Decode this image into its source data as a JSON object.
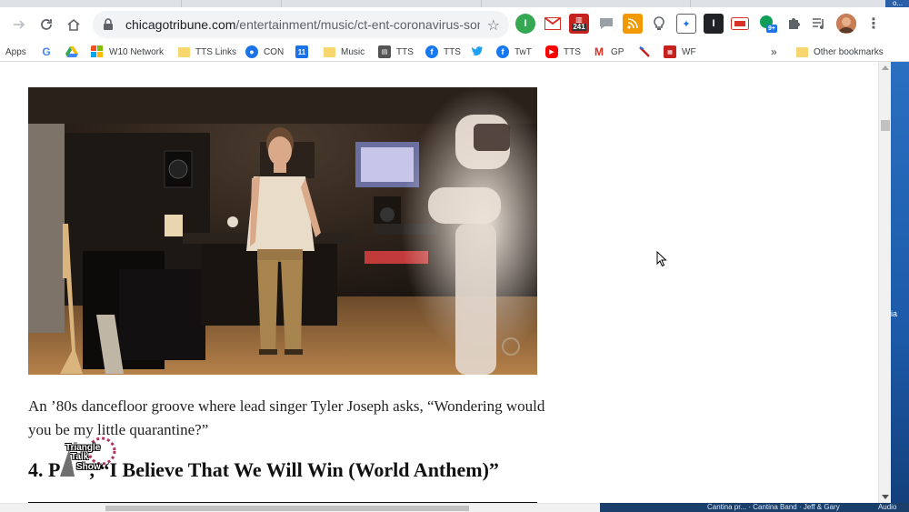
{
  "browser": {
    "url_host": "chicagotribune.com",
    "url_path": "/entertainment/music/ct-ent-coronavirus-song...",
    "badges": {
      "calendar": "241",
      "sync": "9+"
    }
  },
  "bookmarks": [
    {
      "label": "Apps",
      "icon": "apps-grid-icon"
    },
    {
      "label": "",
      "icon": "google-icon"
    },
    {
      "label": "",
      "icon": "drive-icon"
    },
    {
      "label": "W10 Network",
      "icon": "windows-icon"
    },
    {
      "label": "TTS Links",
      "icon": "folder-icon"
    },
    {
      "label": "CON",
      "icon": "person-icon"
    },
    {
      "label": "",
      "icon": "calendar-icon",
      "badge": "11"
    },
    {
      "label": "Music",
      "icon": "folder-icon"
    },
    {
      "label": "TTS",
      "icon": "tts-icon"
    },
    {
      "label": "TTS",
      "icon": "facebook-icon"
    },
    {
      "label": "",
      "icon": "twitter-icon"
    },
    {
      "label": "TwT",
      "icon": "facebook-icon"
    },
    {
      "label": "TTS",
      "icon": "youtube-icon"
    },
    {
      "label": "GP",
      "icon": "gmail-icon"
    },
    {
      "label": "",
      "icon": "feather-icon"
    },
    {
      "label": "WF",
      "icon": "wf-icon"
    }
  ],
  "bookmarks_more": "»",
  "other_bookmarks": "Other bookmarks",
  "article": {
    "caption": "An ’80s dancefloor groove where lead singer Tyler Joseph asks, “Wondering would you be my little quarantine?”",
    "heading_prefix": "4. P",
    "heading_title": ", “I Believe That We Will Win (World Anthem)”"
  },
  "watermark": {
    "line1": "Triangle",
    "line2": "Talk",
    "line3": "Show"
  },
  "desktop": {
    "fragment_top": "o...",
    "fragment_mid": "ia"
  },
  "taskbar": {
    "text": "Cantina pr... · Cantina Band · Jeff & Gary",
    "right_text": "Audio"
  },
  "colors": {
    "accent": "#1a73e8",
    "chrome_bg": "#dee1e6",
    "folder": "#f6d66d"
  }
}
